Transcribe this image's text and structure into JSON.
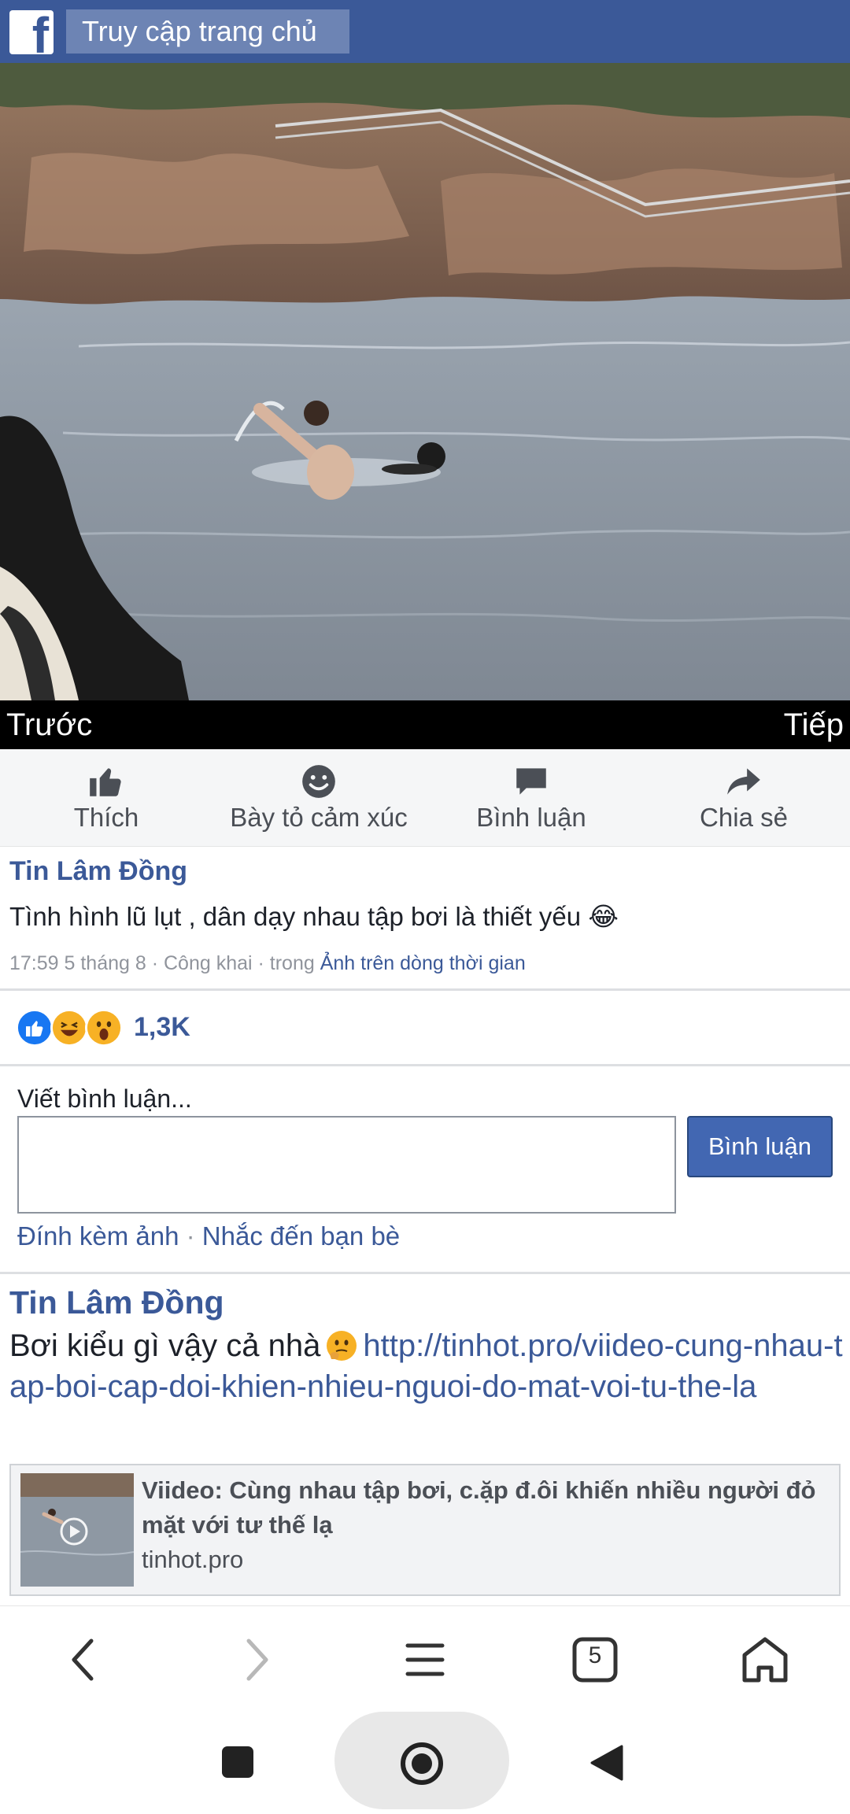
{
  "topbar": {
    "logo_letter": "f",
    "home_link": "Truy cập trang chủ",
    "brand_color": "#3b5998"
  },
  "photo_nav": {
    "prev": "Trước",
    "next": "Tiếp"
  },
  "actions": [
    {
      "label": "Thích",
      "icon": "thumbs-up-icon"
    },
    {
      "label": "Bày tỏ cảm xúc",
      "icon": "smiley-icon"
    },
    {
      "label": "Bình luận",
      "icon": "comment-bubble-icon"
    },
    {
      "label": "Chia sẻ",
      "icon": "share-arrow-icon"
    }
  ],
  "post": {
    "author": "Tin Lâm Đồng",
    "text": "Tình hình lũ lụt , dân dạy nhau tập bơi là thiết yếu",
    "emoji": "😂",
    "meta_prefix": "17:59 5 tháng 8 · Công khai · trong ",
    "meta_link": "Ảnh trên dòng thời gian"
  },
  "reactions": {
    "types": [
      "like",
      "haha",
      "wow"
    ],
    "count": "1,3K"
  },
  "composer": {
    "label": "Viết bình luận...",
    "value": "",
    "button": "Bình luận",
    "attach_photo": "Đính kèm ảnh",
    "separator": " · ",
    "mention_friends": "Nhắc đến bạn bè"
  },
  "post2": {
    "author": "Tin Lâm Đồng",
    "text": "Bơi kiểu gì vậy cả nhà",
    "url": "http://tinhot.pro/viideo-cung-nhau-tap-boi-cap-doi-khien-nhieu-nguoi-do-mat-voi-tu-the-la",
    "preview_title": "Viideo: Cùng nhau tập bơi, c.ặp đ.ôi khiến nhiều người đỏ mặt với tư thế lạ",
    "preview_domain": "tinhot.pro"
  },
  "browser_bar": {
    "tab_count": "5",
    "icons": [
      "back-icon",
      "forward-icon",
      "menu-icon",
      "tabs-icon",
      "home-icon"
    ]
  },
  "system_nav": {
    "icons": [
      "recents-square-icon",
      "home-circle-icon",
      "back-triangle-icon"
    ]
  }
}
